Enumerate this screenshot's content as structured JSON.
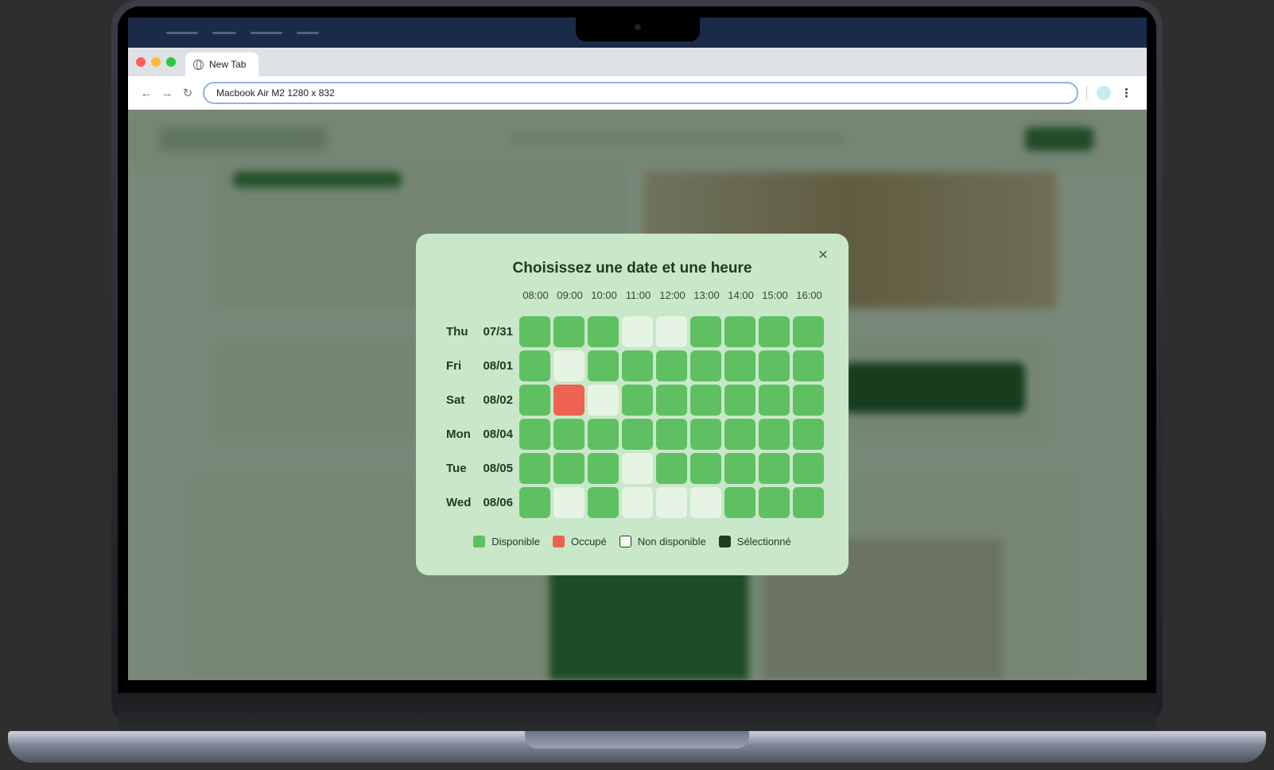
{
  "menubar": {
    "apple_icon": ""
  },
  "browser": {
    "tab_title": "New Tab",
    "url_value": "Macbook Air M2   1280 x 832",
    "back_icon": "←",
    "forward_icon": "→",
    "reload_icon": "↻",
    "menu_icon": "⋮"
  },
  "modal": {
    "title": "Choisissez une date et une heure",
    "close_icon": "✕",
    "hours": [
      "08:00",
      "09:00",
      "10:00",
      "11:00",
      "12:00",
      "13:00",
      "14:00",
      "15:00",
      "16:00"
    ],
    "days": [
      {
        "day": "Thu",
        "date": "07/31",
        "slots": [
          "available",
          "available",
          "available",
          "unavailable",
          "unavailable",
          "available",
          "available",
          "available",
          "available"
        ]
      },
      {
        "day": "Fri",
        "date": "08/01",
        "slots": [
          "available",
          "unavailable",
          "available",
          "available",
          "available",
          "available",
          "available",
          "available",
          "available"
        ]
      },
      {
        "day": "Sat",
        "date": "08/02",
        "slots": [
          "available",
          "busy",
          "unavailable",
          "available",
          "available",
          "available",
          "available",
          "available",
          "available"
        ]
      },
      {
        "day": "Mon",
        "date": "08/04",
        "slots": [
          "available",
          "available",
          "available",
          "available",
          "available",
          "available",
          "available",
          "available",
          "available"
        ]
      },
      {
        "day": "Tue",
        "date": "08/05",
        "slots": [
          "available",
          "available",
          "available",
          "unavailable",
          "available",
          "available",
          "available",
          "available",
          "available"
        ]
      },
      {
        "day": "Wed",
        "date": "08/06",
        "slots": [
          "available",
          "unavailable",
          "available",
          "unavailable",
          "unavailable",
          "unavailable",
          "available",
          "available",
          "available"
        ]
      }
    ],
    "legend": [
      {
        "key": "available",
        "label": "Disponible"
      },
      {
        "key": "busy",
        "label": "Occupé"
      },
      {
        "key": "unavailable",
        "label": "Non disponible"
      },
      {
        "key": "selected",
        "label": "Sélectionné"
      }
    ]
  },
  "colors": {
    "available": "#5fc062",
    "busy": "#ef6150",
    "unavailable": "#e6f4e4",
    "selected": "#1e3d22",
    "modal_bg": "#c9e7c9",
    "menubar_bg": "#1b2a49"
  }
}
